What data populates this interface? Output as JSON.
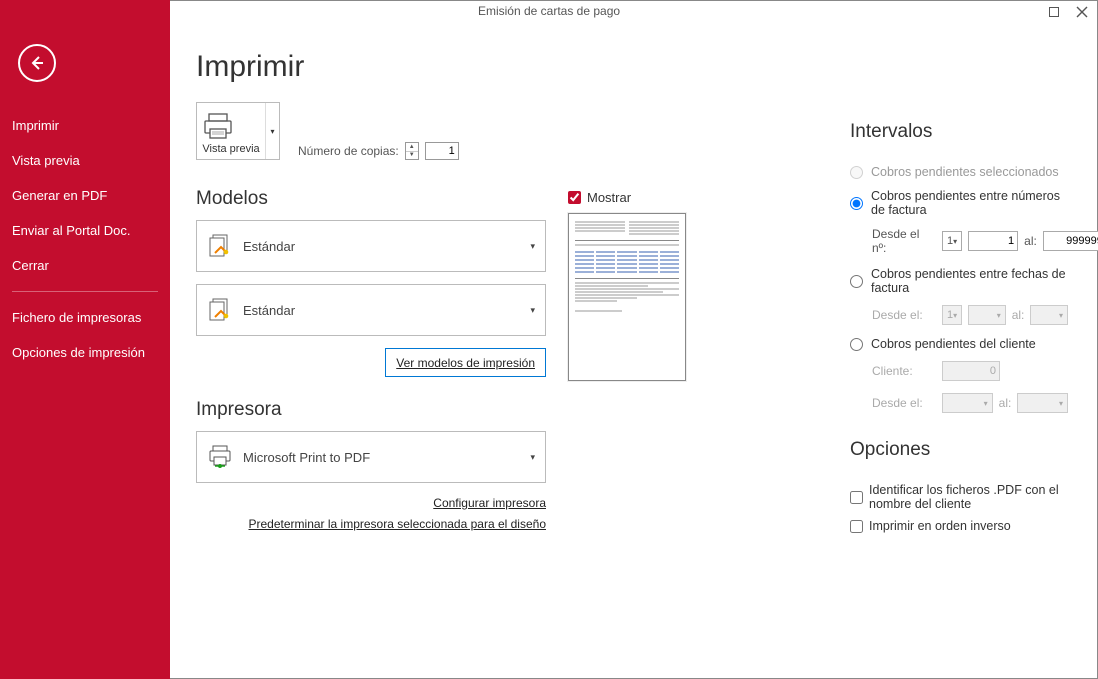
{
  "window": {
    "title": "Emisión de cartas de pago"
  },
  "sidebar": {
    "items": [
      "Imprimir",
      "Vista previa",
      "Generar en PDF",
      "Enviar al Portal Doc.",
      "Cerrar"
    ],
    "items2": [
      "Fichero de impresoras",
      "Opciones de impresión"
    ]
  },
  "page_title": "Imprimir",
  "vista_previa_label": "Vista previa",
  "copies_label": "Número de copias:",
  "copies_value": "1",
  "modelos": {
    "heading": "Modelos",
    "model1": "Estándar",
    "model2": "Estándar",
    "link_ver": "Ver modelos de impresión"
  },
  "mostrar_label": "Mostrar",
  "impresora": {
    "heading": "Impresora",
    "name": "Microsoft Print to PDF",
    "link_config": "Configurar impresora",
    "link_default": "Predeterminar la impresora seleccionada para el diseño"
  },
  "intervalos": {
    "heading": "Intervalos",
    "opt_sel": "Cobros pendientes seleccionados",
    "opt_num": "Cobros pendientes entre números de factura",
    "num_desde_label": "Desde el nº:",
    "num_desde_sel": "1",
    "num_desde_val": "1",
    "al": "al:",
    "num_hasta_val": "999999",
    "opt_fecha": "Cobros pendientes entre fechas de factura",
    "fecha_desde_label": "Desde el:",
    "fecha_desde_sel": "1",
    "opt_cliente": "Cobros pendientes del cliente",
    "cliente_label": "Cliente:",
    "cliente_val": "0",
    "cli_desde_label": "Desde el:"
  },
  "opciones": {
    "heading": "Opciones",
    "chk_pdf": "Identificar los ficheros .PDF con el nombre del cliente",
    "chk_inverso": "Imprimir en orden inverso"
  }
}
